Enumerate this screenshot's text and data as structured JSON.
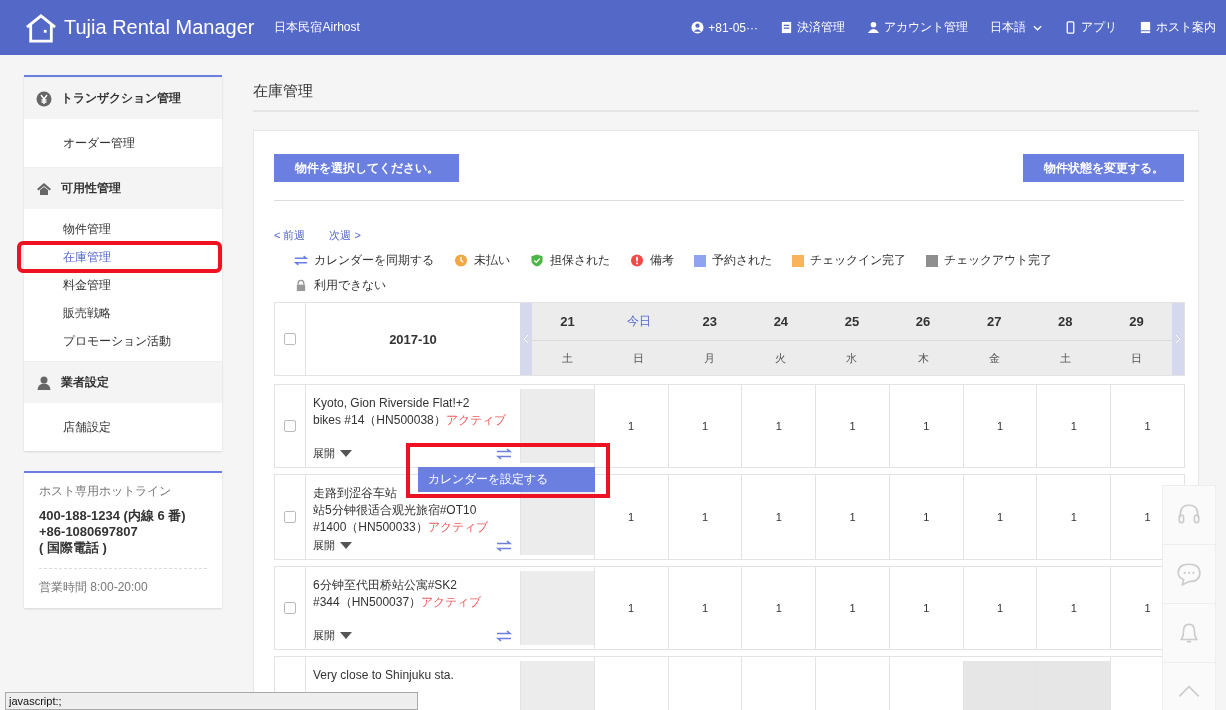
{
  "header": {
    "logo": "Tujia Rental Manager",
    "subtitle": "日本民宿Airhost",
    "nav": [
      {
        "kind": "user",
        "label": "+81-05···"
      },
      {
        "kind": "ledger",
        "label": "決済管理"
      },
      {
        "kind": "person",
        "label": "アカウント管理"
      },
      {
        "kind": "language",
        "label": "日本語"
      },
      {
        "kind": "phone",
        "label": "アプリ"
      },
      {
        "kind": "book",
        "label": "ホスト案内"
      }
    ]
  },
  "sidebar": {
    "groups": [
      {
        "kind": "yen",
        "title": "トランザクション管理",
        "items": [
          {
            "label": "オーダー管理",
            "selected": false,
            "annotated": false
          }
        ]
      },
      {
        "kind": "home",
        "title": "可用性管理",
        "items": [
          {
            "label": "物件管理",
            "selected": false,
            "annotated": false
          },
          {
            "label": "在庫管理",
            "selected": true,
            "annotated": true
          },
          {
            "label": "料金管理",
            "selected": false,
            "annotated": false
          },
          {
            "label": "販売戦略",
            "selected": false,
            "annotated": false
          },
          {
            "label": "プロモーション活動",
            "selected": false,
            "annotated": false
          }
        ]
      },
      {
        "kind": "person",
        "title": "業者設定",
        "items": [
          {
            "label": "店舗設定",
            "selected": false,
            "annotated": false
          }
        ]
      }
    ],
    "hotline": {
      "title": "ホスト専用ホットライン",
      "lines": [
        "400-188-1234 (内線 6 番)",
        "+86-1080697807",
        "( 国際電話 )"
      ],
      "hours": "営業時間 8:00-20:00"
    }
  },
  "page_title": "在庫管理",
  "buttons": {
    "select": "物件を選択してください。",
    "change": "物件状態を変更する。"
  },
  "week_nav": {
    "prev": "< 前週",
    "next": "次週 >"
  },
  "legend": [
    {
      "kind": "sync",
      "label": "カレンダーを同期する"
    },
    {
      "kind": "clock",
      "label": "未払い"
    },
    {
      "kind": "shield",
      "label": "担保された"
    },
    {
      "kind": "alert",
      "label": "備考"
    },
    {
      "kind": "square",
      "color": "#8fa3f0",
      "label": "予約された"
    },
    {
      "kind": "square",
      "color": "#f9b45b",
      "label": "チェックイン完了"
    },
    {
      "kind": "square",
      "color": "#8e8e8e",
      "label": "チェックアウト完了"
    },
    {
      "kind": "lock",
      "label": "利用できない"
    }
  ],
  "calendar": {
    "month": "2017-10",
    "checked": false,
    "days": [
      {
        "date": "21",
        "weekday": "土",
        "today": false
      },
      {
        "date": "今日",
        "weekday": "日",
        "today": true
      },
      {
        "date": "23",
        "weekday": "月",
        "today": false
      },
      {
        "date": "24",
        "weekday": "火",
        "today": false
      },
      {
        "date": "25",
        "weekday": "水",
        "today": false
      },
      {
        "date": "26",
        "weekday": "木",
        "today": false
      },
      {
        "date": "27",
        "weekday": "金",
        "today": false
      },
      {
        "date": "28",
        "weekday": "土",
        "today": false
      },
      {
        "date": "29",
        "weekday": "日",
        "today": false
      }
    ],
    "rows": [
      {
        "name_lines": [
          "Kyoto, Gion Riverside Flat!+2",
          "bikes #14（HN500038）"
        ],
        "status": "アクティブ",
        "expand": "展開",
        "checked": false,
        "cells": [
          {
            "kind": "past"
          },
          {
            "kind": "open",
            "value": "1"
          },
          {
            "kind": "open",
            "value": "1"
          },
          {
            "kind": "open",
            "value": "1"
          },
          {
            "kind": "open",
            "value": "1"
          },
          {
            "kind": "open",
            "value": "1"
          },
          {
            "kind": "open",
            "value": "1"
          },
          {
            "kind": "open",
            "value": "1"
          },
          {
            "kind": "open",
            "value": "1"
          }
        ]
      },
      {
        "name_lines": [
          "走路到涩谷车站",
          "站5分钟很适合观光旅宿#OT10",
          "#1400（HN500033）"
        ],
        "status": "アクティブ",
        "expand": "展開",
        "checked": false,
        "cells": [
          {
            "kind": "past"
          },
          {
            "kind": "open",
            "value": "1"
          },
          {
            "kind": "open",
            "value": "1"
          },
          {
            "kind": "open",
            "value": "1"
          },
          {
            "kind": "open",
            "value": "1"
          },
          {
            "kind": "open",
            "value": "1"
          },
          {
            "kind": "open",
            "value": "1"
          },
          {
            "kind": "open",
            "value": "1"
          },
          {
            "kind": "open",
            "value": "1"
          }
        ]
      },
      {
        "name_lines": [
          "6分钟至代田桥站公寓#SK2",
          "#344（HN500037）"
        ],
        "status": "アクティブ",
        "expand": "展開",
        "checked": false,
        "cells": [
          {
            "kind": "past"
          },
          {
            "kind": "open",
            "value": "1"
          },
          {
            "kind": "open",
            "value": "1"
          },
          {
            "kind": "open",
            "value": "1"
          },
          {
            "kind": "open",
            "value": "1"
          },
          {
            "kind": "open",
            "value": "1"
          },
          {
            "kind": "open",
            "value": "1"
          },
          {
            "kind": "open",
            "value": "1"
          },
          {
            "kind": "open",
            "value": "1"
          }
        ]
      },
      {
        "name_lines": [
          "Very close to Shinjuku sta."
        ],
        "cells": [
          {
            "kind": "past"
          },
          {
            "kind": "open"
          },
          {
            "kind": "open"
          },
          {
            "kind": "open"
          },
          {
            "kind": "open"
          },
          {
            "kind": "open"
          },
          {
            "kind": "blocked"
          },
          {
            "kind": "blocked"
          },
          {
            "kind": "open"
          }
        ]
      }
    ]
  },
  "popup": {
    "label": "カレンダーを設定する",
    "annotated": true
  },
  "status_bar": "javascript:;"
}
